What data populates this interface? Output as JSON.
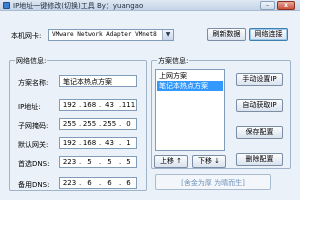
{
  "window": {
    "title": "IP地址一键修改(切换)工具 By：yuangao",
    "minimize_glyph": "–",
    "close_glyph": "x"
  },
  "adapter": {
    "label": "本机网卡:",
    "selected": "VMware Network Adapter VMnet8",
    "refresh_button": "刷新数据",
    "connect_button": "网络连接"
  },
  "network_info": {
    "group_title": "网络信息:",
    "scheme_label": "方案名称:",
    "scheme_value": "笔记本热点方案",
    "ip_label": "IP地址:",
    "ip": [
      "192",
      "168",
      "43",
      "111"
    ],
    "mask_label": "子网掩码:",
    "mask": [
      "255",
      "255",
      "255",
      "0"
    ],
    "gateway_label": "默认网关:",
    "gateway": [
      "192",
      "168",
      "43",
      "1"
    ],
    "dns1_label": "首选DNS:",
    "dns1": [
      "223",
      "5",
      "5",
      "5"
    ],
    "dns2_label": "备用DNS:",
    "dns2": [
      "223",
      "6",
      "6",
      "6"
    ]
  },
  "scheme_info": {
    "group_title": "方案信息:",
    "items": [
      "上网方案",
      "笔记本热点方案"
    ],
    "selected_index": 1,
    "move_up": "上移 ↑",
    "move_down": "下移 ↓"
  },
  "actions": {
    "manual_ip": "手动设置IP",
    "auto_ip": "自动获取IP",
    "save_config": "保存配置",
    "delete_config": "删除配置"
  },
  "footer": {
    "slogan": "[舍金为厚 为晴而生]"
  }
}
